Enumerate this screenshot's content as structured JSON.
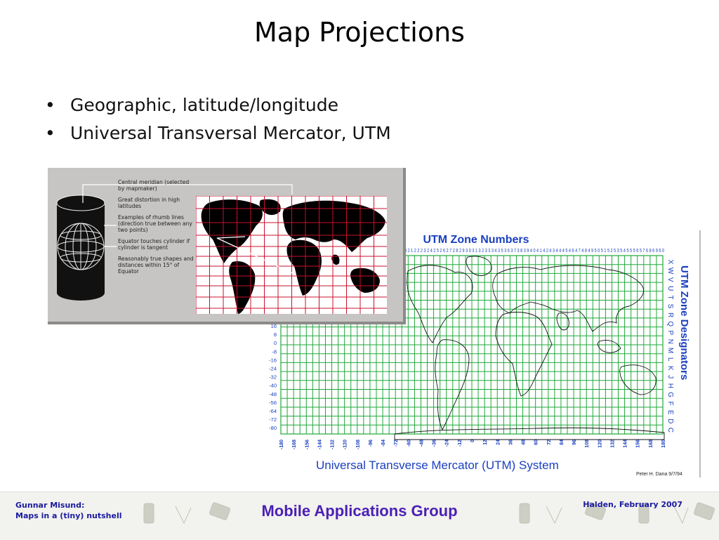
{
  "slide": {
    "title": "Map Projections",
    "bullets": [
      "Geographic, latitude/longitude",
      "Universal Transversal Mercator, UTM"
    ]
  },
  "mercator_figure": {
    "notes": [
      "Central meridian (selected by mapmaker)",
      "Great distortion in high latitudes",
      "Examples of rhumb lines (direction true between any two points)",
      "Equator touches cylinder if cylinder is tangent",
      "Reasonably true shapes and distances within 15° of Equator"
    ]
  },
  "utm_figure": {
    "top_title": "UTM Zone Numbers",
    "zone_numbers": "0 2 1 2 2 2 3 2 4 2 5 2 6 2 7 2 8 2 9 3 0 3 1 3 2 3 3 3 4 3 5 3 6 3 7 3 8 3 9 4 0 4 1 4 2 4 3 4 4 4 5 4 6 4 7 4 8 4 9 5 0 5 1 5 2 5 3 5 4 5 5 5 6 5 7 6 8 6 9 6 0",
    "side_title": "UTM Zone Designators",
    "designators": [
      "X",
      "W",
      "V",
      "U",
      "T",
      "S",
      "R",
      "Q",
      "P",
      "N",
      "M",
      "L",
      "K",
      "J",
      "H",
      "G",
      "F",
      "E",
      "D",
      "C"
    ],
    "lat_labels": [
      "16",
      "8",
      "0",
      "-8",
      "-16",
      "-24",
      "-32",
      "-40",
      "-48",
      "-56",
      "-64",
      "-72",
      "-80"
    ],
    "lon_labels": [
      "-180",
      "-168",
      "-156",
      "-144",
      "-132",
      "-120",
      "-108",
      "-96",
      "-84",
      "-72",
      "-60",
      "-48",
      "-36",
      "-24",
      "-12",
      "0",
      "12",
      "24",
      "36",
      "48",
      "60",
      "72",
      "84",
      "96",
      "108",
      "120",
      "132",
      "144",
      "156",
      "168",
      "180"
    ],
    "caption": "Universal Transverse Mercator (UTM) System",
    "credit": "Peter H. Dana 9/7/94",
    "colors": {
      "grid": "#1fa83a",
      "title": "#1a3fbf",
      "coast": "#111111"
    }
  },
  "footer": {
    "author": "Gunnar Misund:",
    "talk": "Maps in a (tiny) nutshell",
    "group": "Mobile Applications Group",
    "place_date": "Halden, February 2007"
  }
}
